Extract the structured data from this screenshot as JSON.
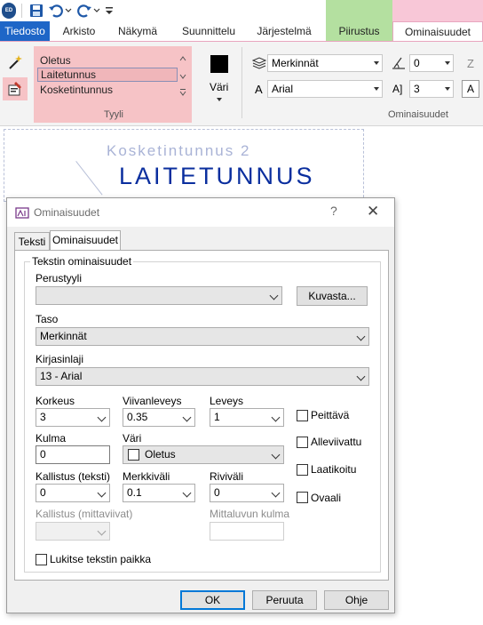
{
  "qat": {
    "logo": "ED",
    "icons": [
      "save-icon",
      "undo-icon",
      "redo-icon",
      "customize-icon"
    ]
  },
  "tabs": {
    "file": "Tiedosto",
    "archive": "Arkisto",
    "view": "Näkymä",
    "design": "Suunnittelu",
    "system": "Järjestelmä",
    "drawing": "Piirustus",
    "properties": "Ominaisuudet"
  },
  "ribbon": {
    "style_group": {
      "label": "Tyyli",
      "items": [
        "Oletus",
        "Laitetunnus",
        "Kosketintunnus"
      ],
      "selected": "Laitetunnus"
    },
    "color_label": "Väri",
    "layer_value": "Merkinnät",
    "font_value": "Arial",
    "angle_value": "0",
    "size_value": "3",
    "z_label": "Z",
    "properties_label": "Ominaisuudet"
  },
  "document": {
    "subtitle": "Kosketintunnus 2",
    "title": "LAITETUNNUS"
  },
  "dialog": {
    "title": "Ominaisuudet",
    "help_glyph": "?",
    "close_glyph": "✕",
    "tabs": [
      "Teksti",
      "Ominaisuudet"
    ],
    "group_title": "Tekstin ominaisuudet",
    "base_style": {
      "label": "Perustyyli",
      "value": "",
      "button": "Kuvasta..."
    },
    "layer": {
      "label": "Taso",
      "value": "Merkinnät"
    },
    "font": {
      "label": "Kirjasinlaji",
      "value": "13 - Arial"
    },
    "height": {
      "label": "Korkeus",
      "value": "3"
    },
    "line_width": {
      "label": "Viivanleveys",
      "value": "0.35"
    },
    "width": {
      "label": "Leveys",
      "value": "1"
    },
    "angle": {
      "label": "Kulma",
      "value": "0"
    },
    "color": {
      "label": "Väri",
      "value": "Oletus"
    },
    "slant_text": {
      "label": "Kallistus (teksti)",
      "value": "0"
    },
    "char_spacing": {
      "label": "Merkkiväli",
      "value": "0.1"
    },
    "line_spacing": {
      "label": "Riviväli",
      "value": "0"
    },
    "slant_dim": {
      "label": "Kallistus (mittaviivat)",
      "value": ""
    },
    "dim_angle": {
      "label": "Mittaluvun kulma",
      "value": ""
    },
    "checkboxes": {
      "cover": "Peittävä",
      "underline": "Alleviivattu",
      "boxed": "Laatikoitu",
      "oval": "Ovaali",
      "lock": "Lukitse tekstin paikka"
    },
    "buttons": {
      "ok": "OK",
      "cancel": "Peruuta",
      "help": "Ohje"
    }
  }
}
